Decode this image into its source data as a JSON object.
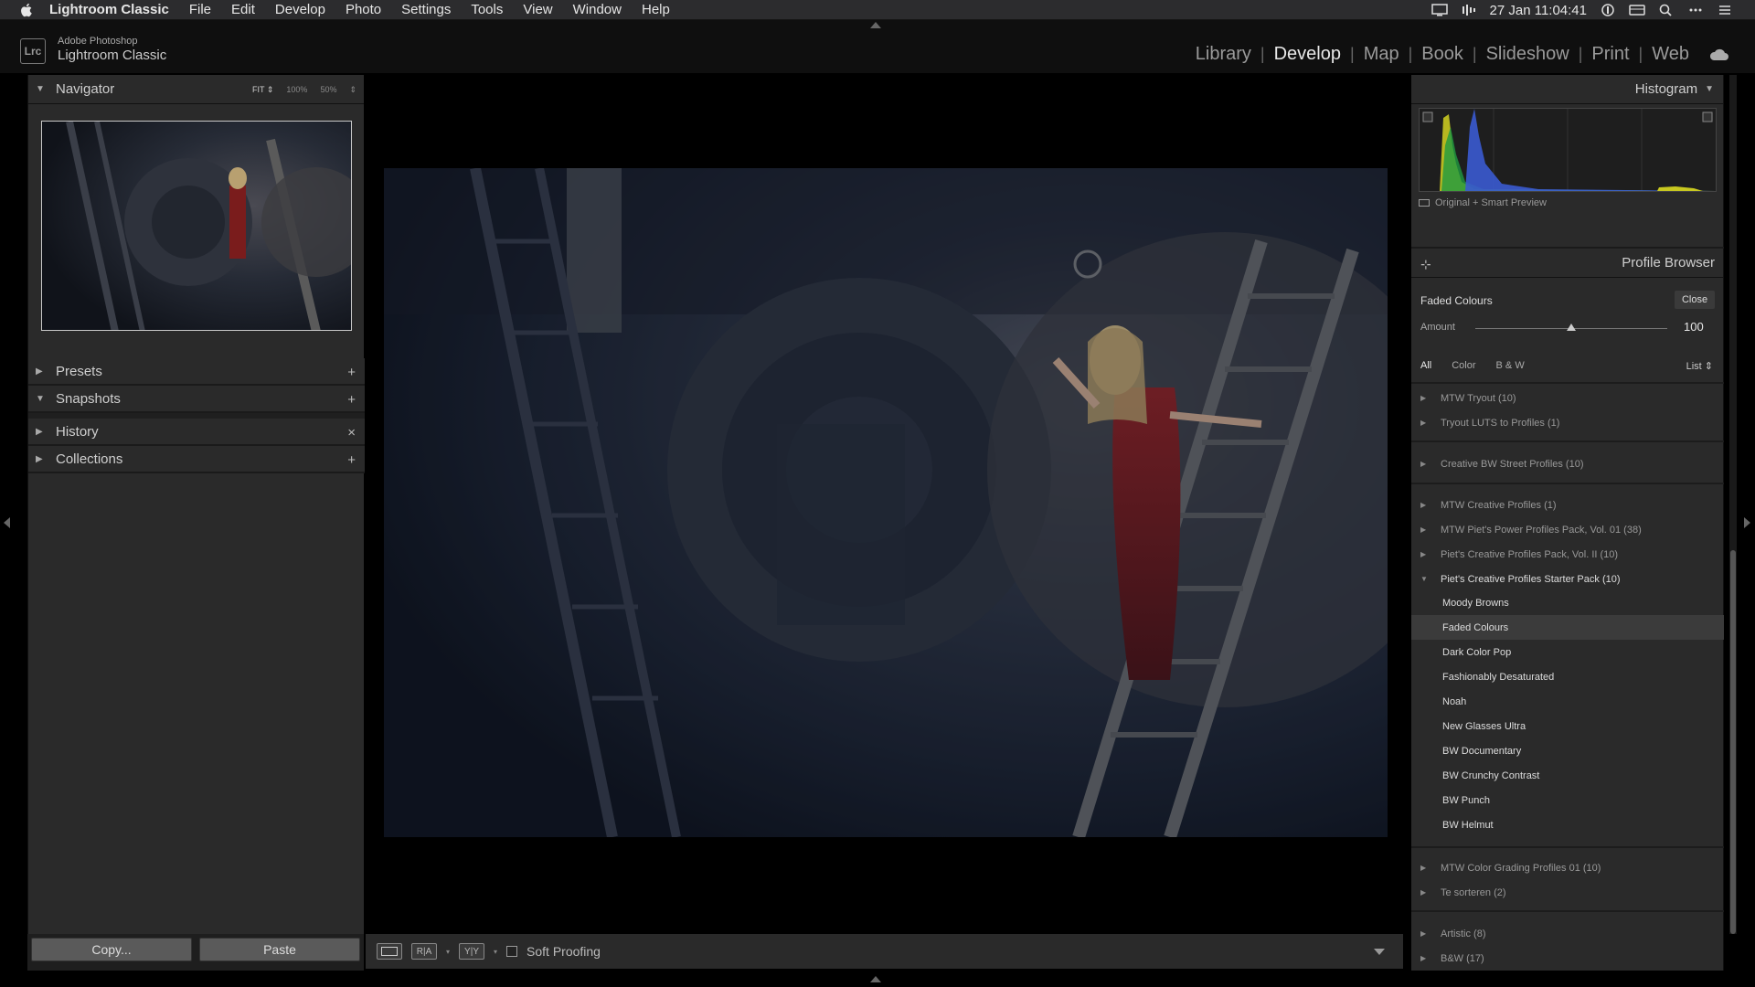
{
  "menubar": {
    "app": "Lightroom Classic",
    "items": [
      "File",
      "Edit",
      "Develop",
      "Photo",
      "Settings",
      "Tools",
      "View",
      "Window",
      "Help"
    ],
    "clock": "27 Jan  11:04:41"
  },
  "identity": {
    "logo": "Lrc",
    "line1": "Adobe Photoshop",
    "line2": "Lightroom Classic"
  },
  "modules": {
    "items": [
      "Library",
      "Develop",
      "Map",
      "Book",
      "Slideshow",
      "Print",
      "Web"
    ],
    "active": "Develop"
  },
  "left": {
    "navigator": {
      "title": "Navigator",
      "zoom": [
        "FIT ⇕",
        "100%",
        "50%",
        "⇕"
      ]
    },
    "sections": [
      {
        "label": "Presets",
        "icon": "+"
      },
      {
        "label": "Snapshots",
        "icon": "+"
      },
      {
        "label": "History",
        "icon": "×"
      },
      {
        "label": "Collections",
        "icon": "+"
      }
    ],
    "copy": "Copy...",
    "paste": "Paste"
  },
  "toolbar": {
    "soft_proofing": "Soft Proofing"
  },
  "right": {
    "histogram": {
      "title": "Histogram",
      "label": "Original + Smart Preview"
    },
    "profile_browser": {
      "title": "Profile Browser",
      "current": "Faded Colours",
      "close": "Close",
      "amount_label": "Amount",
      "amount": "100",
      "amount_fraction": 0.5,
      "filters": [
        "All",
        "Color",
        "B & W"
      ],
      "view": "List ⇕",
      "groups_a": [
        "MTW Tryout (10)",
        "Tryout LUTS to Profiles (1)"
      ],
      "groups_b": [
        "Creative BW Street Profiles (10)"
      ],
      "groups_c": [
        "MTW Creative Profiles (1)",
        "MTW Piet's Power Profiles Pack, Vol. 01 (38)",
        "Piet's Creative Profiles Pack, Vol. II (10)"
      ],
      "open_group": "Piet's Creative Profiles Starter Pack (10)",
      "profiles": [
        "Moody Browns",
        "Faded Colours",
        "Dark Color Pop",
        "Fashionably Desaturated",
        "Noah",
        "New Glasses Ultra",
        "BW Documentary",
        "BW Crunchy Contrast",
        "BW Punch",
        "BW Helmut"
      ],
      "groups_d": [
        "MTW Color Grading Profiles 01 (10)",
        "Te sorteren (2)"
      ],
      "groups_e": [
        "Artistic (8)",
        "B&W (17)"
      ]
    }
  }
}
